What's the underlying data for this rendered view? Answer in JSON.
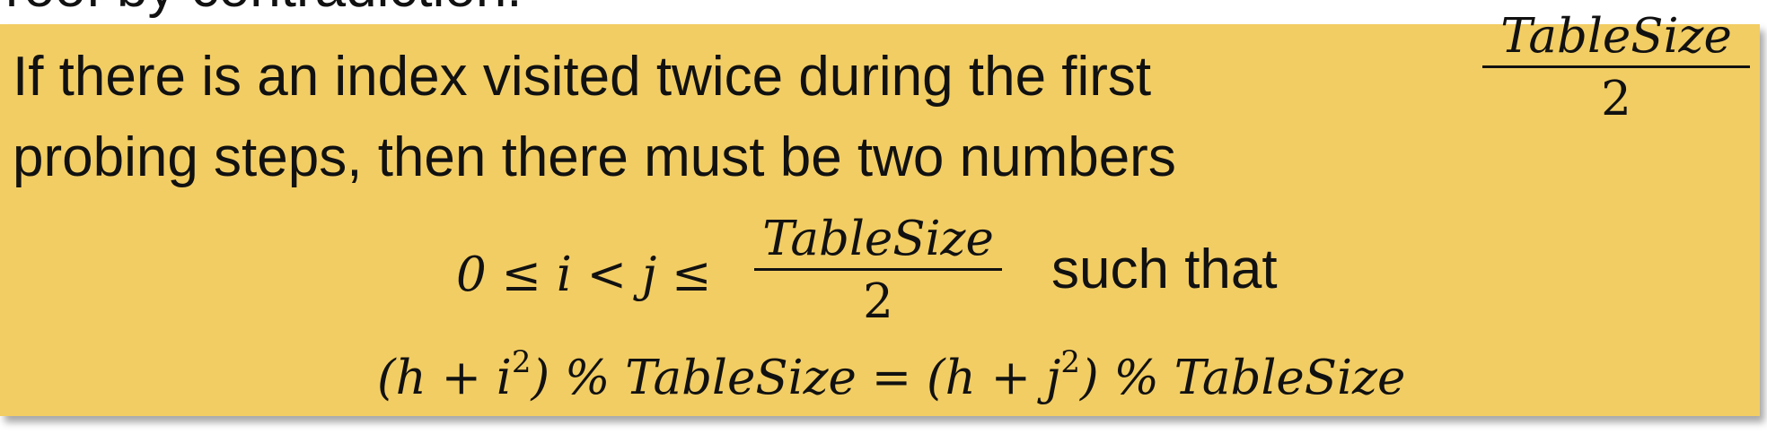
{
  "slide": {
    "clipped_heading": "roof by contradiction.",
    "line1": "If there is an index visited twice during the first",
    "line2": "probing steps, then there must be two numbers",
    "fraction_top": {
      "numerator": "TableSize",
      "denominator": "2"
    },
    "inequality": {
      "lhs": "0 ≤ i < j ≤",
      "numerator": "TableSize",
      "denominator": "2"
    },
    "such_that": "such that",
    "equation": {
      "left_open": "(h + i",
      "left_exp": "2",
      "left_close": ") % TableSize = (h + j",
      "right_exp": "2",
      "right_close": ") % TableSize"
    }
  },
  "colors": {
    "highlight": "#f2cd63",
    "text": "#111111",
    "background": "#ffffff"
  }
}
